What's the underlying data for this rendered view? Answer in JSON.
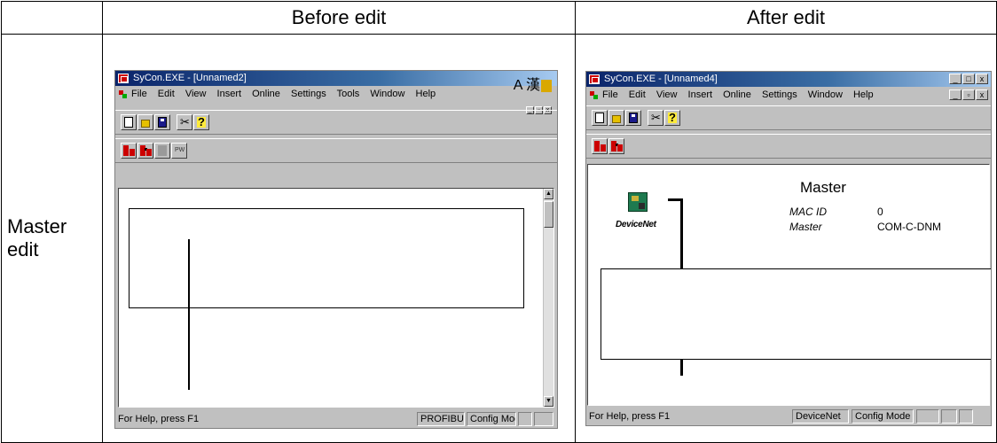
{
  "table": {
    "header_before": "Before edit",
    "header_after": "After edit",
    "row_label_line1": "Master",
    "row_label_line2": "edit"
  },
  "before_window": {
    "title": "SyCon.EXE - [Unnamed2]",
    "ime_text": "A 漢",
    "menu": [
      "File",
      "Edit",
      "View",
      "Insert",
      "Online",
      "Settings",
      "Tools",
      "Window",
      "Help"
    ],
    "status_text": "For Help, press F1",
    "status_bus": "PROFIBUS",
    "status_mode": "Config Mode",
    "toolbar2_pw": "PW"
  },
  "after_window": {
    "title": "SyCon.EXE - [Unnamed4]",
    "menu": [
      "File",
      "Edit",
      "View",
      "Insert",
      "Online",
      "Settings",
      "Window",
      "Help"
    ],
    "device_label": "DeviceNet",
    "master_title": "Master",
    "mac_id_key": "MAC ID",
    "mac_id_value": "0",
    "master_key": "Master",
    "master_value": "COM-C-DNM",
    "status_text": "For Help, press F1",
    "status_bus": "DeviceNet",
    "status_mode": "Config Mode"
  },
  "window_buttons": {
    "minimize": "_",
    "maximize": "□",
    "close": "x",
    "restore": "▫"
  },
  "icons": [
    "app-icon",
    "document-icon",
    "new-file-icon",
    "open-folder-icon",
    "save-icon",
    "cut-icon",
    "help-icon",
    "insert-master-icon",
    "insert-slave-icon",
    "scroll-up-icon",
    "scroll-down-icon",
    "devicenet-device-icon"
  ]
}
